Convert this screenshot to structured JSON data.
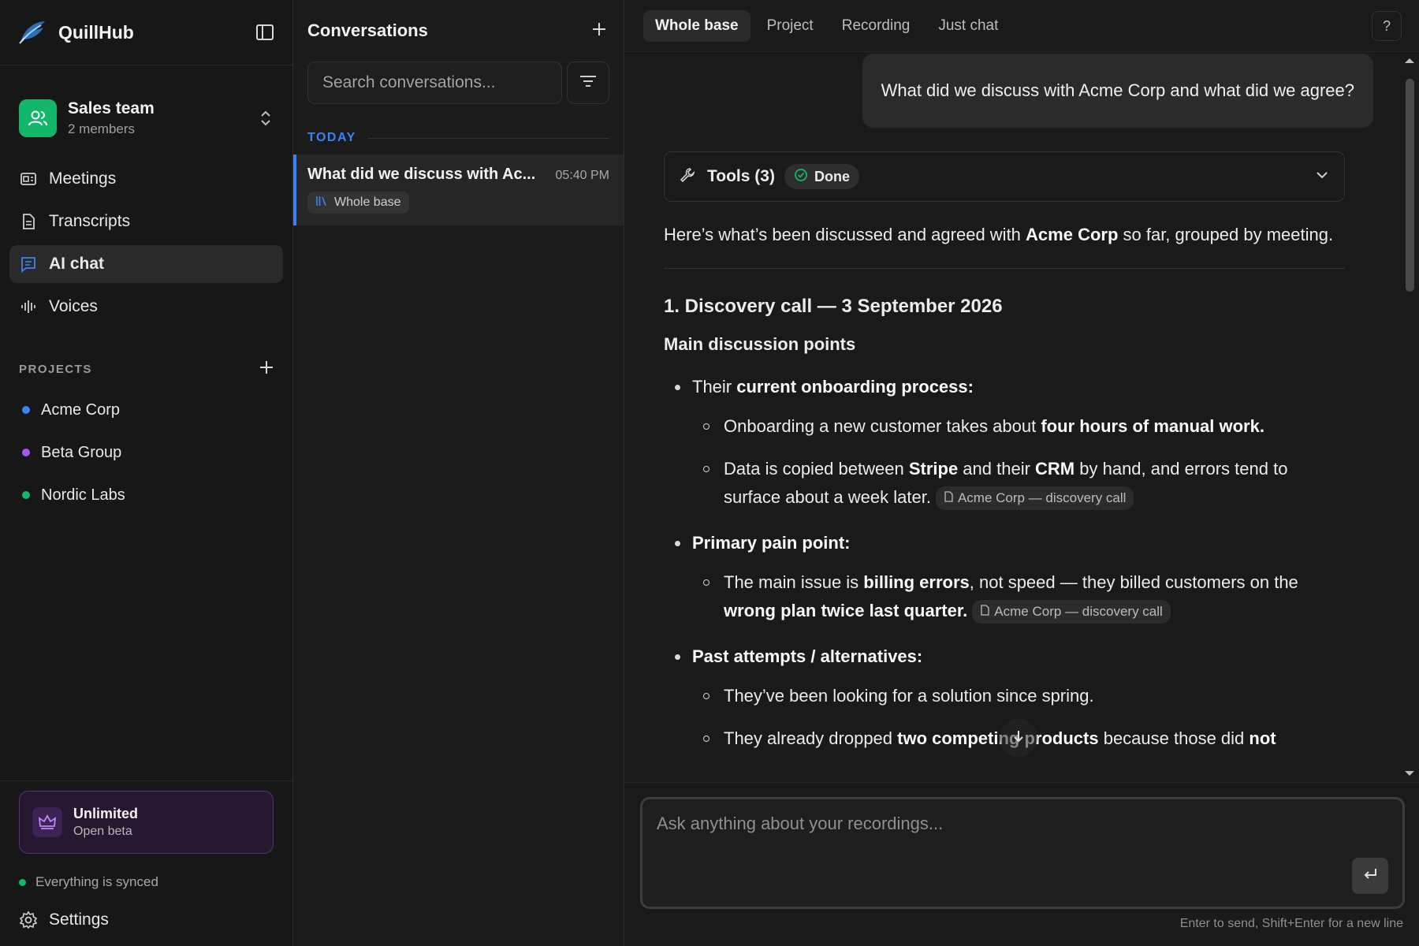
{
  "app": {
    "name": "QuillHub"
  },
  "team": {
    "name": "Sales team",
    "members": "2 members"
  },
  "nav": [
    {
      "label": "Meetings",
      "icon": "meetings-icon"
    },
    {
      "label": "Transcripts",
      "icon": "transcripts-icon"
    },
    {
      "label": "AI chat",
      "icon": "chat-icon",
      "active": true
    },
    {
      "label": "Voices",
      "icon": "voices-icon"
    }
  ],
  "projects": {
    "label": "PROJECTS",
    "items": [
      {
        "label": "Acme Corp",
        "color": "#3b82f6"
      },
      {
        "label": "Beta Group",
        "color": "#a855f7"
      },
      {
        "label": "Nordic Labs",
        "color": "#12b76a"
      }
    ]
  },
  "plan": {
    "title": "Unlimited",
    "subtitle": "Open beta"
  },
  "sync": {
    "label": "Everything is synced"
  },
  "settings": {
    "label": "Settings"
  },
  "conversations": {
    "title": "Conversations",
    "search_placeholder": "Search conversations...",
    "group": "TODAY",
    "items": [
      {
        "title": "What did we discuss with Ac...",
        "time": "05:40 PM",
        "chip": "Whole base"
      }
    ]
  },
  "tabs": [
    {
      "label": "Whole base",
      "active": true
    },
    {
      "label": "Project"
    },
    {
      "label": "Recording"
    },
    {
      "label": "Just chat"
    }
  ],
  "help": {
    "label": "?"
  },
  "chat": {
    "user_message": "What did we discuss with Acme Corp and what did we agree?",
    "tools": {
      "label": "Tools (3)",
      "status": "Done"
    },
    "intro": {
      "a": "Here’s what’s been discussed and agreed with ",
      "b": "Acme Corp",
      "c": " so far, grouped by meeting."
    },
    "section1": {
      "heading": "1. Discovery call — 3 September 2026",
      "subheading": "Main discussion points",
      "b1": {
        "pre": "Their ",
        "strong": "current onboarding process:"
      },
      "b1s1": {
        "a": "Onboarding a new customer takes about ",
        "b": "four hours of manual work."
      },
      "b1s2": {
        "a": "Data is copied between ",
        "b": "Stripe",
        "c": " and their ",
        "d": "CRM",
        "e": " by hand, and errors tend to surface about a week later.",
        "cite": "Acme Corp — discovery call"
      },
      "b2": {
        "strong": "Primary pain point:"
      },
      "b2s1": {
        "a": "The main issue is ",
        "b": "billing errors",
        "c": ", not speed — they billed customers on the ",
        "d": "wrong plan twice last quarter.",
        "cite": "Acme Corp — discovery call"
      },
      "b3": {
        "strong": "Past attempts / alternatives:"
      },
      "b3s1": {
        "a": "They’ve been looking for a solution since spring."
      },
      "b3s2": {
        "a": "They already dropped ",
        "b": "two competing products",
        "c": " because those did ",
        "d": "not"
      }
    }
  },
  "composer": {
    "placeholder": "Ask anything about your recordings...",
    "hint": "Enter to send, Shift+Enter for a new line"
  }
}
